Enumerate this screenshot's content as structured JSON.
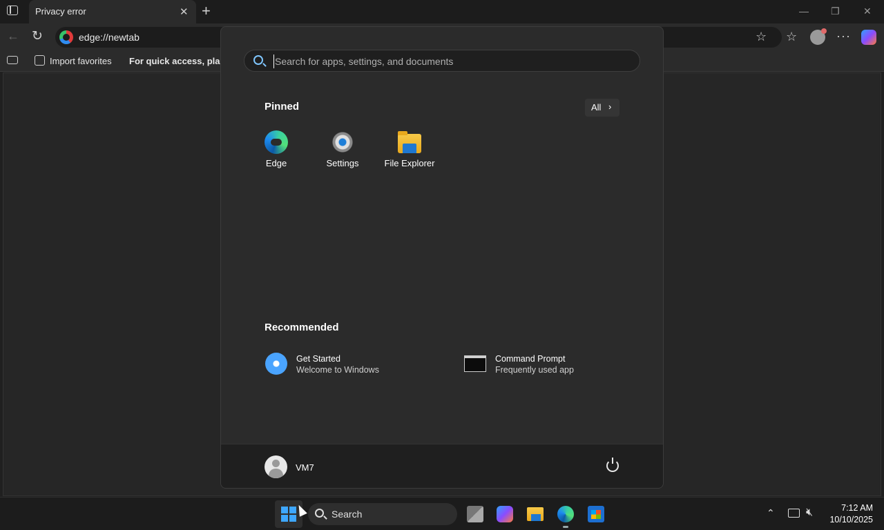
{
  "browser": {
    "tab_title": "Privacy error",
    "tab_close": "✕",
    "new_tab": "+",
    "window_controls": {
      "minimize": "—",
      "restore": "❐",
      "close": "✕"
    },
    "address": "edge://newtab",
    "bookmarks": {
      "import_label": "Import favorites",
      "hint": "For quick access, place y"
    }
  },
  "start_menu": {
    "search_placeholder": "Search for apps, settings, and documents",
    "pinned_heading": "Pinned",
    "all_label": "All",
    "pinned": [
      {
        "label": "Edge",
        "icon": "edge-icon"
      },
      {
        "label": "Settings",
        "icon": "settings-icon"
      },
      {
        "label": "File Explorer",
        "icon": "folder-icon"
      }
    ],
    "recommended_heading": "Recommended",
    "recommended": [
      {
        "title": "Get Started",
        "subtitle": "Welcome to Windows",
        "icon": "get-started-icon"
      },
      {
        "title": "Command Prompt",
        "subtitle": "Frequently used app",
        "icon": "cmd-icon"
      }
    ],
    "user_name": "VM7"
  },
  "taskbar": {
    "search_label": "Search",
    "time": "7:12 AM",
    "date": "10/10/2025"
  },
  "colors": {
    "accent": "#3ea7ff",
    "menu_bg": "#2b2b2b",
    "taskbar_bg": "#1c1c1c"
  }
}
